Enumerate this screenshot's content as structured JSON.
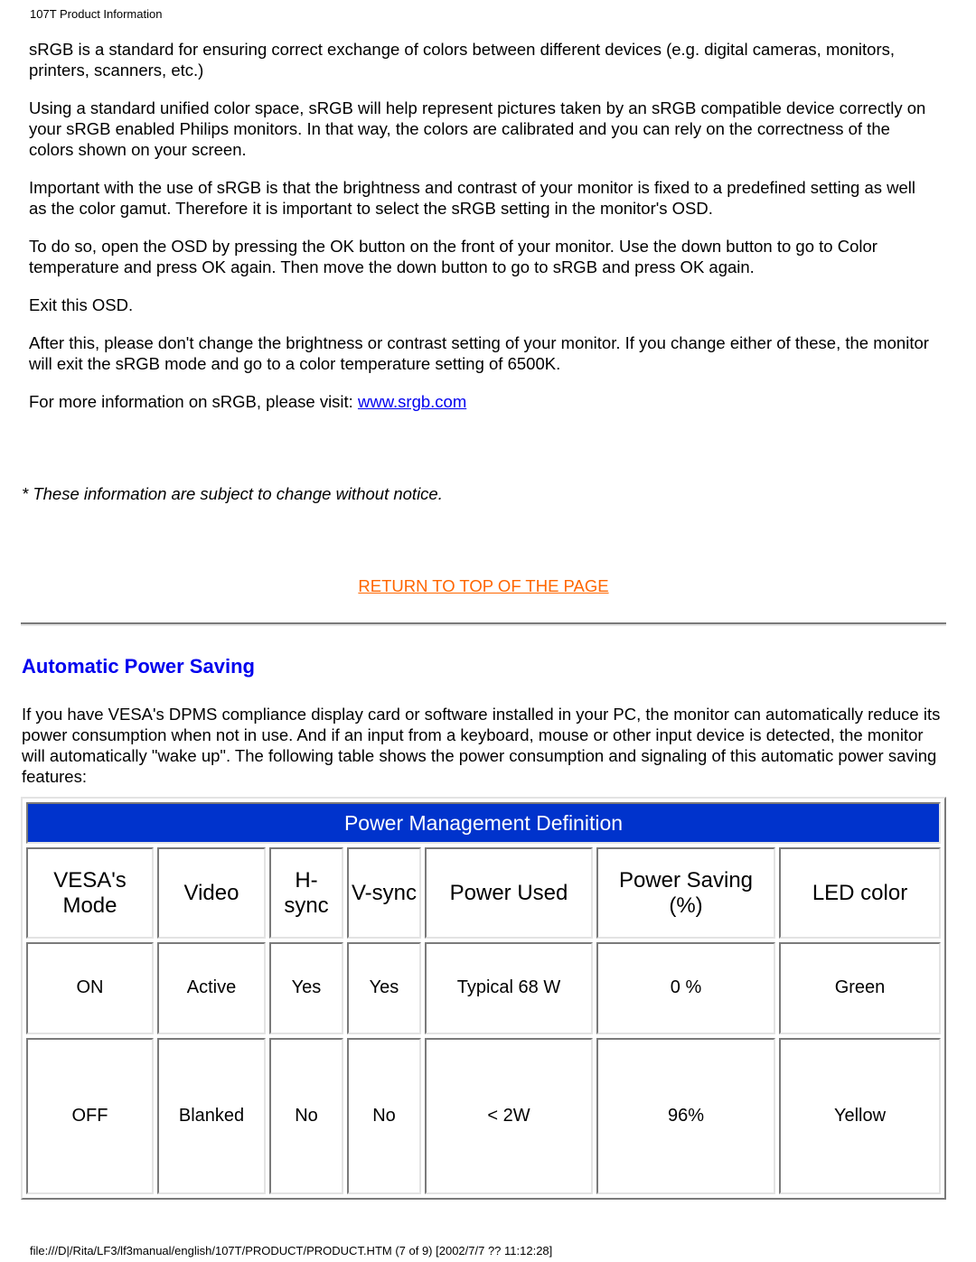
{
  "header": {
    "title": "107T Product Information"
  },
  "srgb_section": {
    "paragraphs": [
      "sRGB is a standard for ensuring correct exchange of colors between different devices (e.g. digital cameras, monitors, printers, scanners, etc.)",
      "Using a standard unified color space, sRGB will help represent pictures taken by an sRGB compatible device correctly on your sRGB enabled Philips monitors. In that way, the colors are calibrated and you can rely on the correctness of the colors shown on your screen.",
      "Important with the use of sRGB is that the brightness and contrast of your monitor is fixed to a predefined setting as well as the color gamut. Therefore it is important to select the sRGB setting in the monitor's OSD.",
      "To do so, open the OSD by pressing the OK button on the front of your monitor. Use the down button to go to Color temperature and press OK again. Then move the down button to go to sRGB and press OK again.",
      "Exit this OSD.",
      "After this, please don't change the brightness or contrast setting of your monitor. If you change either of these, the monitor will exit the sRGB mode and go to a color temperature setting of 6500K."
    ],
    "more_info_prefix": "For more information on sRGB, please visit: ",
    "more_info_link": "www.srgb.com"
  },
  "notice": "* These information are subject to change without notice.",
  "return_link": "RETURN TO TOP OF THE PAGE",
  "power_section": {
    "title": "Automatic Power Saving",
    "intro": "If you have VESA's DPMS compliance display card or software installed in your PC, the monitor can automatically reduce its power consumption when not in use. And if an input from a keyboard, mouse or other input device is detected, the monitor will automatically \"wake up\". The following table shows the power consumption and signaling of this automatic power saving features:",
    "table": {
      "caption": "Power Management Definition",
      "headers": {
        "mode_line1": "VESA's",
        "mode_line2": "Mode",
        "video": "Video",
        "hsync": "H-sync",
        "vsync": "V-sync",
        "power_used": "Power Used",
        "saving_line1": "Power Saving",
        "saving_line2": "(%)",
        "led": "LED color"
      },
      "rows": [
        [
          "ON",
          "Active",
          "Yes",
          "Yes",
          "Typical 68 W",
          "0 %",
          "Green"
        ],
        [
          "OFF",
          "Blanked",
          "No",
          "No",
          "< 2W",
          "96%",
          "Yellow"
        ]
      ]
    }
  },
  "colors": {
    "caption_bg": "#0033cc",
    "heading": "#0000ee",
    "return_link": "#ff6600",
    "link": "#0000ee"
  },
  "footer": {
    "text": "file:///D|/Rita/LF3/lf3manual/english/107T/PRODUCT/PRODUCT.HTM (7 of 9) [2002/7/7 ?? 11:12:28]"
  }
}
